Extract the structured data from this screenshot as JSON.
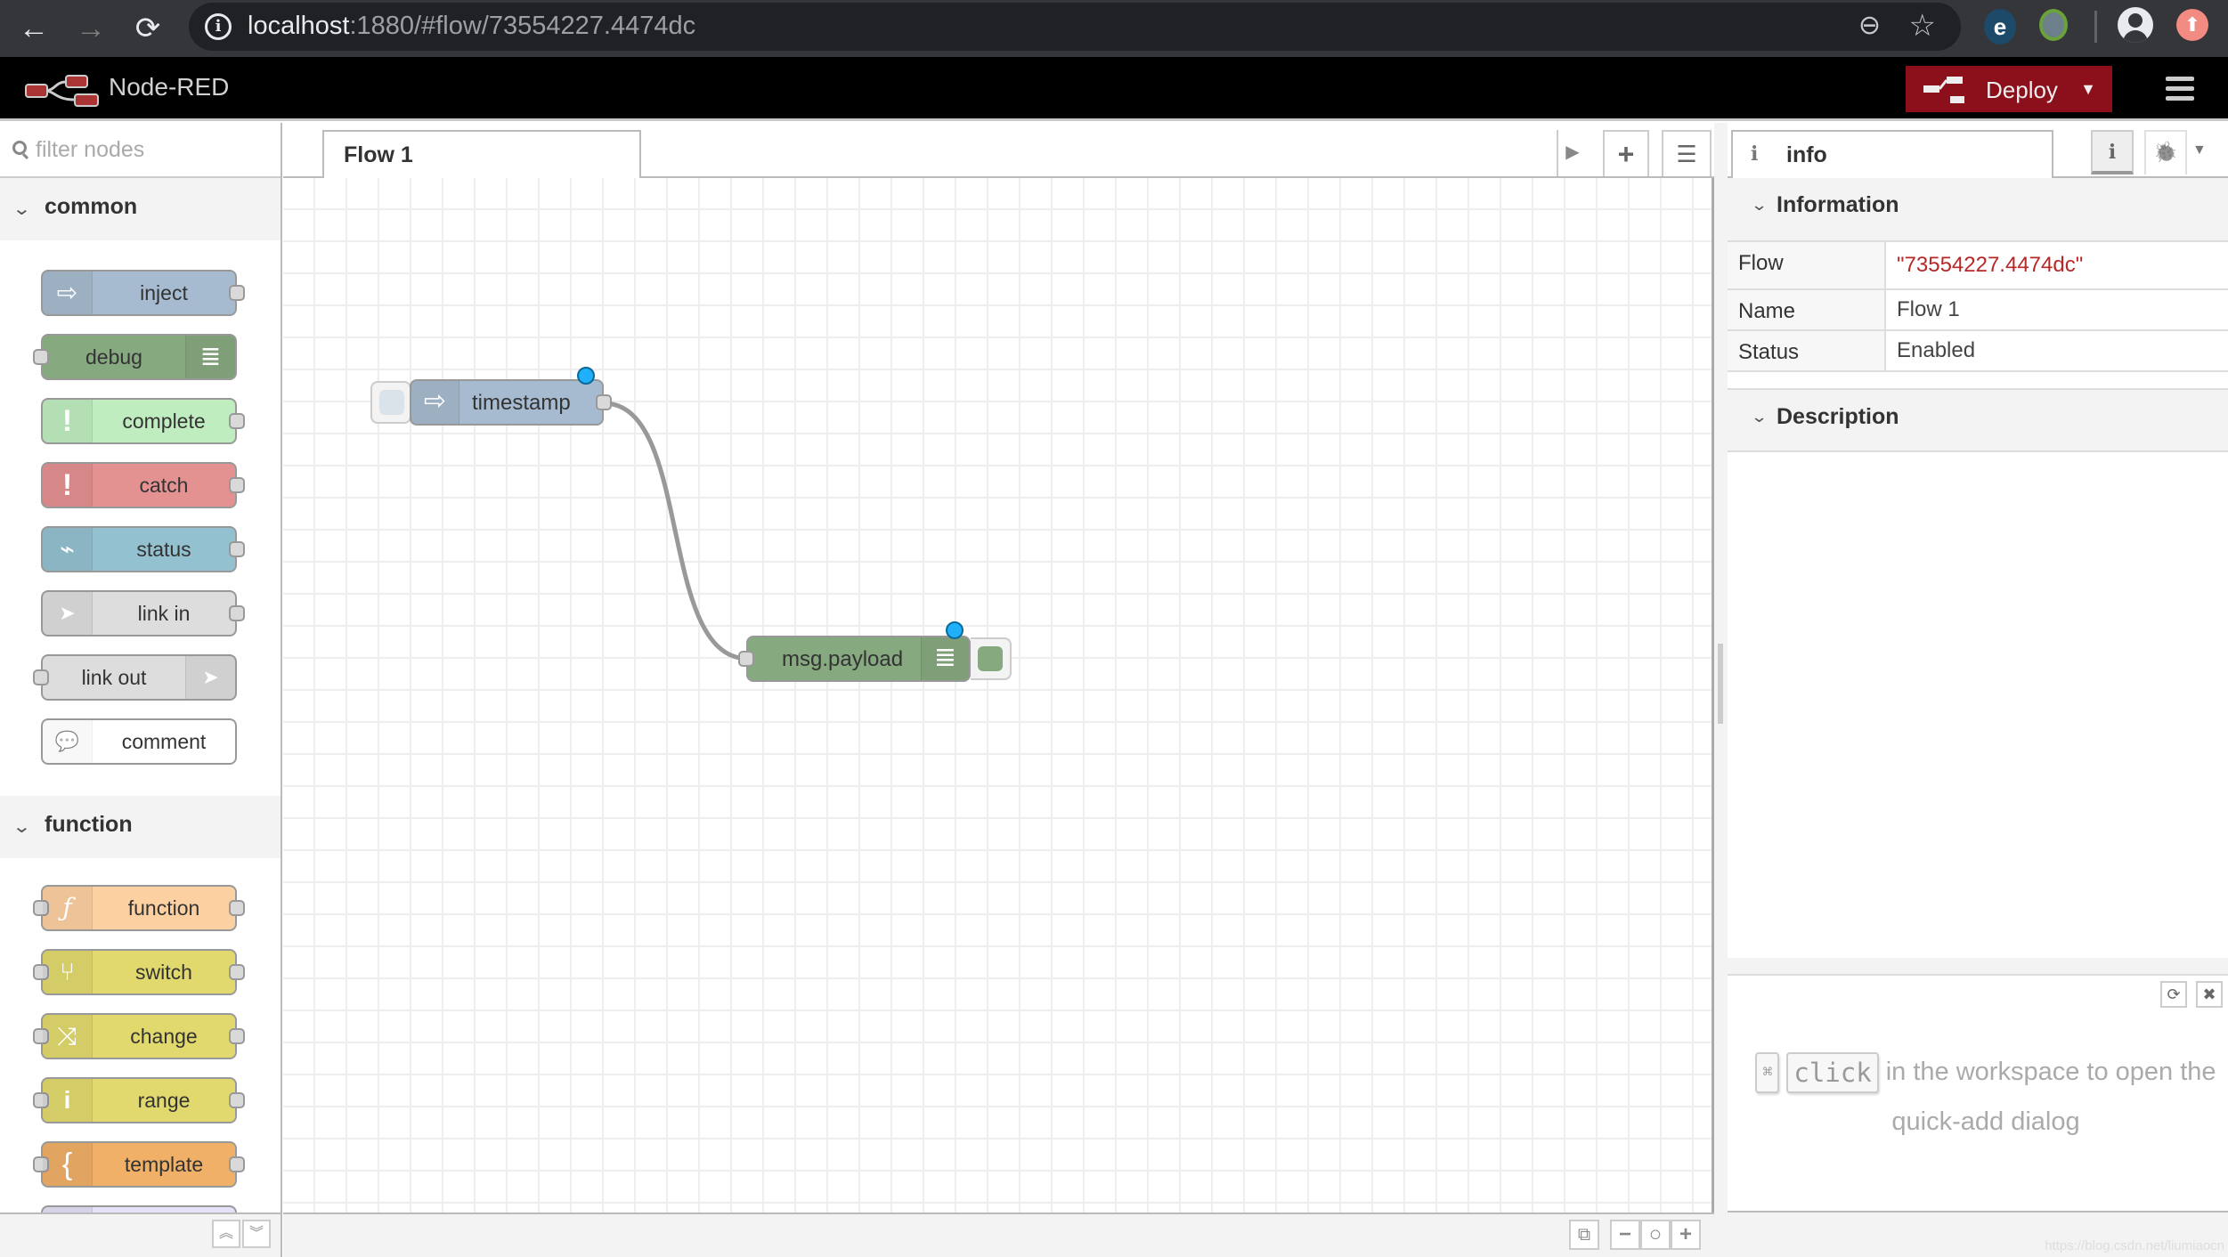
{
  "browser": {
    "url_host": "localhost",
    "url_rest": ":1880/#flow/73554227.4474dc",
    "nav": {
      "back": "←",
      "forward": "→",
      "reload": "⟳"
    },
    "icons": [
      "info-icon",
      "zoom-out-icon",
      "star-icon",
      "extension-icon",
      "extension-icon",
      "profile-icon",
      "update-icon"
    ]
  },
  "header": {
    "title": "Node-RED",
    "deploy_label": "Deploy",
    "deploy_caret": "▼",
    "accent": "#8c101c"
  },
  "palette": {
    "filter_placeholder": "filter nodes",
    "categories": [
      {
        "label": "common",
        "nodes": [
          {
            "label": "inject",
            "color": "#a6bbcf",
            "icon": "⇨",
            "ports": "out"
          },
          {
            "label": "debug",
            "color": "#87a980",
            "icon": "≣",
            "ports": "in"
          },
          {
            "label": "complete",
            "color": "#c0edc0",
            "icon": "!",
            "ports": "out"
          },
          {
            "label": "catch",
            "color": "#e49191",
            "icon": "!",
            "ports": "out"
          },
          {
            "label": "status",
            "color": "#94c1d0",
            "icon": "⌁",
            "ports": "out"
          },
          {
            "label": "link in",
            "color": "#dddddd",
            "icon": "➤",
            "ports": "out"
          },
          {
            "label": "link out",
            "color": "#dddddd",
            "icon": "➤",
            "ports": "in"
          },
          {
            "label": "comment",
            "color": "#ffffff",
            "icon": "💬",
            "ports": "none"
          }
        ]
      },
      {
        "label": "function",
        "nodes": [
          {
            "label": "function",
            "color": "#fdd0a2",
            "icon": "ƒ",
            "ports": "both"
          },
          {
            "label": "switch",
            "color": "#e2d96e",
            "icon": "⑂",
            "ports": "both"
          },
          {
            "label": "change",
            "color": "#e2d96e",
            "icon": "⤨",
            "ports": "both"
          },
          {
            "label": "range",
            "color": "#e2d96e",
            "icon": "i",
            "ports": "both"
          },
          {
            "label": "template",
            "color": "#f0b068",
            "icon": "{",
            "ports": "both"
          }
        ]
      }
    ],
    "footer": {
      "collapse_all": "︽",
      "expand_all": "︾"
    }
  },
  "workspace": {
    "tabs": [
      {
        "label": "Flow 1",
        "active": true
      }
    ],
    "tab_buttons": {
      "scroll": "▶",
      "add": "+",
      "list": "☰"
    },
    "nodes": [
      {
        "id": "timestamp",
        "label": "timestamp",
        "type": "inject",
        "color": "#a6bbcf",
        "changed": true
      },
      {
        "id": "msg-payload",
        "label": "msg.payload",
        "type": "debug",
        "color": "#87a980",
        "changed": true
      }
    ],
    "wires": [
      {
        "from": "timestamp",
        "to": "msg-payload"
      }
    ],
    "footer": {
      "navigator": "⧉",
      "zoom_out": "−",
      "zoom_reset": "○",
      "zoom_in": "+"
    }
  },
  "sidebar": {
    "tab_label": "info",
    "tab_icon": "i",
    "buttons": {
      "info": "i",
      "debug": "🐞",
      "more": "▼"
    },
    "information_title": "Information",
    "info_rows": [
      {
        "key": "Flow",
        "value": "\"73554227.4474dc\""
      },
      {
        "key": "Name",
        "value": "Flow 1"
      },
      {
        "key": "Status",
        "value": "Enabled"
      }
    ],
    "description_title": "Description",
    "tip": {
      "key1": "⌘",
      "key2": "click",
      "text": " in the workspace to open the quick-add dialog"
    },
    "tip_buttons": {
      "refresh": "⟳",
      "close": "✖"
    },
    "watermark": "https://blog.csdn.net/liumiaocn"
  }
}
